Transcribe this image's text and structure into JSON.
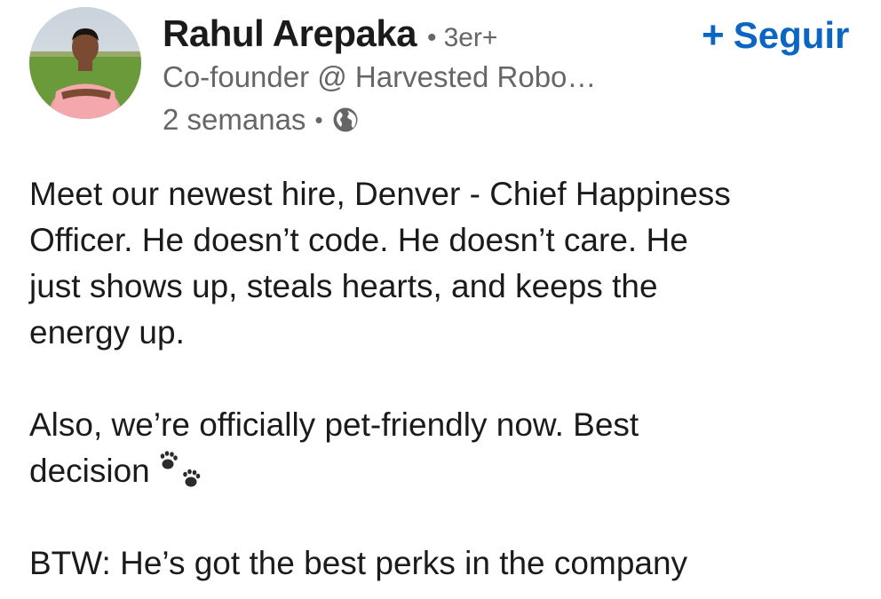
{
  "author": {
    "name": "Rahul Arepaka",
    "degree": "3er+",
    "headline": "Co-founder @ Harvested Robo…",
    "time": "2 semanas",
    "separator": "•"
  },
  "follow": {
    "plus": "+",
    "label": "Seguir",
    "color": "#0a66c2"
  },
  "post": {
    "paragraph_1": [
      "Meet our newest hire, Denver - Chief Happiness",
      "Officer. He doesn’t code. He doesn’t care. He",
      "just shows up, steals hearts, and keeps the",
      "energy up."
    ],
    "paragraph_2": [
      "Also, we’re officially pet-friendly now. Best",
      "decision"
    ],
    "paragraph_3": [
      "BTW: He’s got the best perks in the company"
    ]
  },
  "icons": {
    "visibility": "globe-icon",
    "emoji": "paw-prints-icon",
    "avatar": "profile-photo"
  }
}
